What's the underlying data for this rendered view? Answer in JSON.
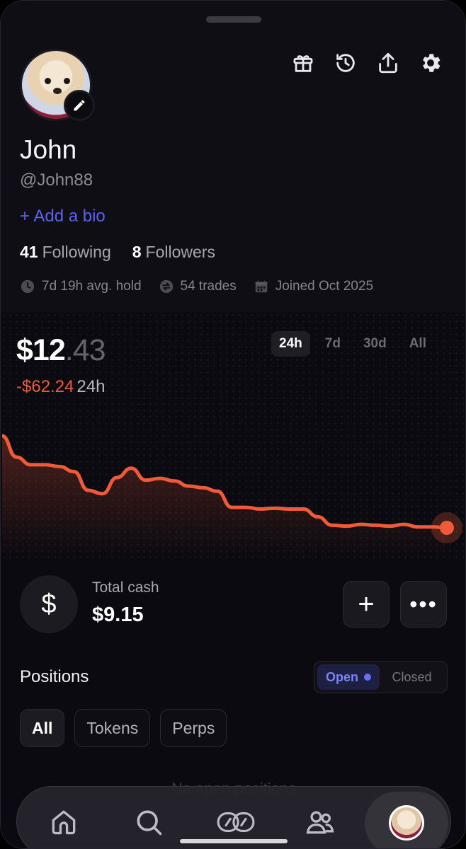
{
  "profile": {
    "name": "John",
    "handle": "@John88",
    "add_bio": "+ Add a bio",
    "following_count": "41",
    "following_label": "Following",
    "followers_count": "8",
    "followers_label": "Followers",
    "avg_hold": "7d 19h avg. hold",
    "trades": "54 trades",
    "joined": "Joined Oct 2025"
  },
  "header_icons": [
    "gift-icon",
    "history-icon",
    "share-icon",
    "settings-icon"
  ],
  "portfolio": {
    "balance_whole": "$12",
    "balance_cents": ".43",
    "change": "-$62.24",
    "change_period": "24h",
    "ranges": [
      "24h",
      "7d",
      "30d",
      "All"
    ],
    "active_range": "24h"
  },
  "chart_data": {
    "type": "line",
    "color": "#f05a38",
    "y": [
      78,
      75.5,
      74.6,
      74.6,
      74.4,
      73.8,
      71.6,
      71.2,
      73.1,
      74.2,
      72.8,
      73.0,
      72.7,
      72.1,
      71.9,
      71.5,
      69.6,
      69.6,
      69.4,
      69.5,
      69.4,
      69.4,
      68.5,
      67.5,
      67.4,
      67.6,
      67.5,
      67.4,
      67.6,
      67.3,
      67.3,
      67.2
    ]
  },
  "cash": {
    "label": "Total cash",
    "value": "$9.15",
    "icon_glyph": "$",
    "plus_glyph": "+",
    "more_glyph": "•••"
  },
  "positions": {
    "title": "Positions",
    "toggle_open": "Open",
    "toggle_closed": "Closed",
    "filters": [
      "All",
      "Tokens",
      "Perps"
    ],
    "empty_text": "No open positions"
  },
  "nav": [
    "home-icon",
    "search-icon",
    "trade-icon",
    "friends-icon",
    "profile-avatar"
  ],
  "colors": {
    "accent": "#5b63f2",
    "negative": "#ee5a3a",
    "background": "#0b0a10"
  }
}
